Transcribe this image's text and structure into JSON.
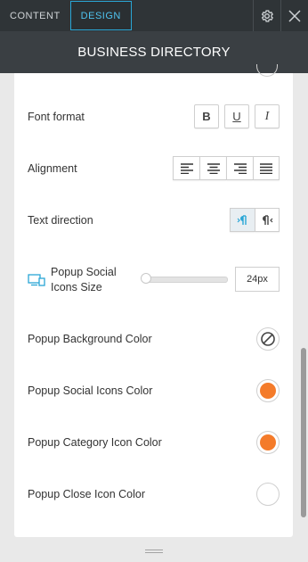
{
  "tabs": [
    {
      "label": "CONTENT",
      "active": false
    },
    {
      "label": "DESIGN",
      "active": true
    }
  ],
  "icons": {
    "settings": "gear-icon",
    "close": "close-icon"
  },
  "header": {
    "title": "BUSINESS DIRECTORY"
  },
  "settings": {
    "font_format": {
      "label": "Font format",
      "options": [
        "B",
        "U",
        "I"
      ]
    },
    "alignment": {
      "label": "Alignment",
      "options": [
        "align-left",
        "align-center",
        "align-right",
        "align-justify"
      ]
    },
    "text_direction": {
      "label": "Text direction",
      "options": [
        "ltr",
        "rtl"
      ],
      "selected": "ltr"
    },
    "popup_social_icons_size": {
      "label": "Popup Social Icons Size",
      "value": "24px",
      "slider_fraction": 0.0
    },
    "popup_background_color": {
      "label": "Popup Background Color",
      "value": "none"
    },
    "popup_social_icons_color": {
      "label": "Popup Social Icons Color",
      "value": "#f47b2a"
    },
    "popup_category_icon_color": {
      "label": "Popup Category Icon Color",
      "value": "#f47b2a"
    },
    "popup_close_icon_color": {
      "label": "Popup Close Icon Color",
      "value": "#ffffff"
    }
  },
  "colors": {
    "accent": "#2aa6d6",
    "orange": "#f47b2a",
    "topbar": "#2f3437",
    "header": "#3a3f43"
  }
}
